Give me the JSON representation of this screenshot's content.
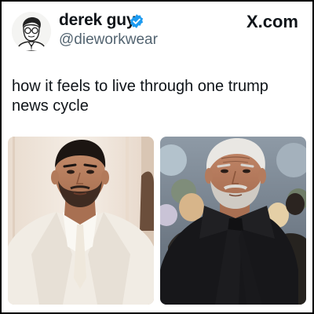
{
  "author": {
    "display_name": "derek guy",
    "handle": "@dieworkwear",
    "verified_icon": "verified-badge-icon",
    "avatar_icon": "cartoon-man-with-glasses-avatar"
  },
  "brand": {
    "label": "X.com"
  },
  "tweet": {
    "text": "how it feels to live through one trump news cycle"
  },
  "media": [
    {
      "description_icon": "young-man-white-suit-photo"
    },
    {
      "description_icon": "aged-man-black-bow-photo"
    }
  ],
  "colors": {
    "verified_blue": "#1d9bf0",
    "text_primary": "#0f1419",
    "text_secondary": "#536471",
    "border": "#000000"
  }
}
